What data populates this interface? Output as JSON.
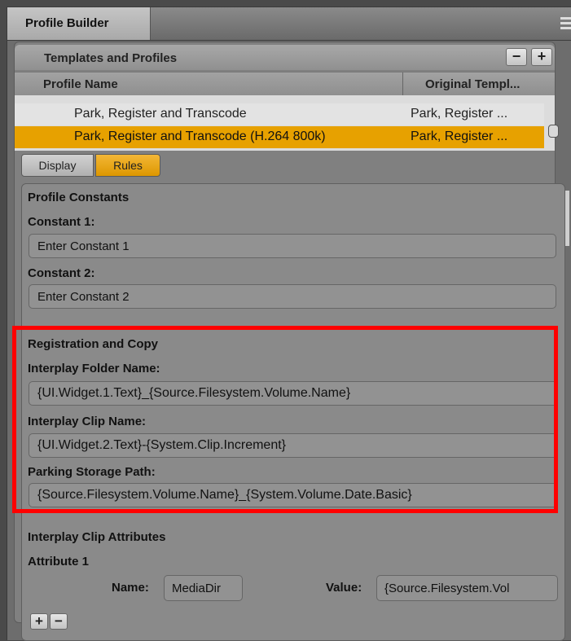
{
  "window": {
    "tab_title": "Profile Builder",
    "menu_icon": "hamburger-menu-icon"
  },
  "templates": {
    "title": "Templates and Profiles",
    "remove_label": "−",
    "add_label": "+",
    "columns": {
      "profile_name": "Profile Name",
      "original_template": "Original Templ..."
    },
    "rows": [
      {
        "name": "Park, Register and Transcode",
        "template": "Park, Register ...",
        "selected": false
      },
      {
        "name": "Park, Register and Transcode (H.264 800k)",
        "template": "Park, Register ...",
        "selected": true
      }
    ]
  },
  "view_toggle": {
    "display": "Display",
    "rules": "Rules",
    "active": "Rules"
  },
  "constants": {
    "section_title": "Profile Constants",
    "constant1_label": "Constant 1:",
    "constant1_value": "Enter Constant 1",
    "constant2_label": "Constant 2:",
    "constant2_value": "Enter Constant 2"
  },
  "registration": {
    "section_title": "Registration and Copy",
    "folder_label": "Interplay Folder Name:",
    "folder_value": "{UI.Widget.1.Text}_{Source.Filesystem.Volume.Name}",
    "clip_label": "Interplay Clip Name:",
    "clip_value": "{UI.Widget.2.Text}-{System.Clip.Increment}",
    "parking_label": "Parking Storage Path:",
    "parking_value": "{Source.Filesystem.Volume.Name}_{System.Volume.Date.Basic}"
  },
  "attributes": {
    "section_title": "Interplay Clip Attributes",
    "attribute_label": "Attribute 1",
    "name_label": "Name:",
    "name_value": "MediaDir",
    "value_label": "Value:",
    "value_value": "{Source.Filesystem.Vol",
    "add_label": "+",
    "remove_label": "−"
  },
  "colors": {
    "accent": "#e7a100",
    "highlight_border": "#ff0000"
  }
}
